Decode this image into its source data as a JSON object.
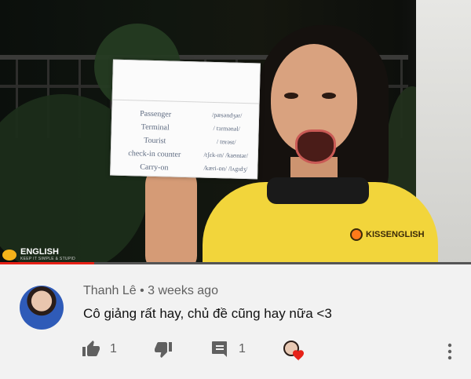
{
  "video": {
    "card_rows": [
      {
        "word": "Passenger",
        "phonetic": "/pæsəndʒər/"
      },
      {
        "word": "Terminal",
        "phonetic": "/ tɜrmənəl/"
      },
      {
        "word": "Tourist",
        "phonetic": "/ tʊrəst/"
      },
      {
        "word": "check-in counter",
        "phonetic": "/tʃɛk-ɪn/ /kaʊntər/"
      },
      {
        "word": "Carry-on",
        "phonetic": "/kæri-ɒn/ /lʌgɪdʒ/"
      }
    ],
    "brand_name": "ENGLISH",
    "brand_tagline": "KEEP IT SIMPLE & STUPID",
    "shirt_logo_text": "KISSENGLISH",
    "progress_fraction": 0.2
  },
  "comment": {
    "author": "Thanh Lê",
    "separator": "•",
    "time": "3 weeks ago",
    "text": "Cô giảng rất hay, chủ đề cũng hay nữa <3",
    "like_count": "1",
    "reply_count": "1",
    "icons": [
      "thumb-up-icon",
      "thumb-down-icon",
      "reply-icon",
      "creator-heart-icon",
      "more-vert-icon"
    ],
    "colors": {
      "icon": "#606060",
      "heart": "#e62117"
    }
  }
}
